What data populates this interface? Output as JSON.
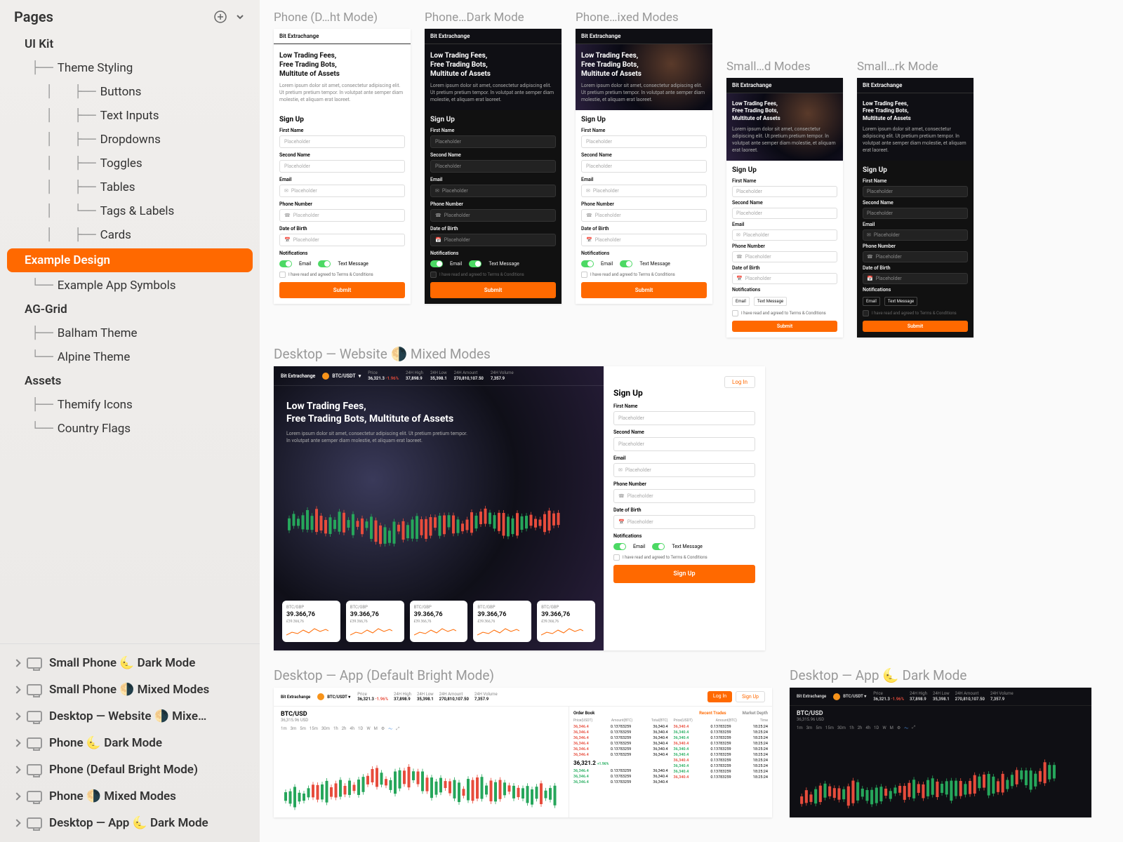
{
  "sidebar": {
    "title": "Pages",
    "sections": [
      {
        "label": "UI Kit",
        "type": "section"
      },
      {
        "label": "Theme Styling",
        "type": "child",
        "prefix": "├──"
      },
      {
        "label": "Buttons",
        "type": "gchild",
        "prefix": "├──"
      },
      {
        "label": "Text Inputs",
        "type": "gchild",
        "prefix": "├──"
      },
      {
        "label": "Dropdowns",
        "type": "gchild",
        "prefix": "├──"
      },
      {
        "label": "Toggles",
        "type": "gchild",
        "prefix": "├──"
      },
      {
        "label": "Tables",
        "type": "gchild",
        "prefix": "├──"
      },
      {
        "label": "Tags & Labels",
        "type": "gchild",
        "prefix": "└──"
      },
      {
        "label": "Cards",
        "type": "gchild",
        "prefix": "├──"
      },
      {
        "label": "Example Design",
        "type": "selected"
      },
      {
        "label": "Example App Symbols",
        "type": "child",
        "prefix": "└──"
      },
      {
        "label": "AG-Grid",
        "type": "section"
      },
      {
        "label": "Balham Theme",
        "type": "child",
        "prefix": "├──"
      },
      {
        "label": "Alpine Theme",
        "type": "child",
        "prefix": "└──"
      },
      {
        "label": "Assets",
        "type": "section"
      },
      {
        "label": "Themify Icons",
        "type": "child",
        "prefix": "├──"
      },
      {
        "label": "Country Flags",
        "type": "child",
        "prefix": "└──"
      }
    ],
    "artboards": [
      "Small Phone 🌜 Dark Mode",
      "Small Phone 🌗 Mixed Modes",
      "Desktop — Website 🌗 Mixe…",
      "Phone 🌜 Dark Mode",
      "Phone (Defaul Bright Mode)",
      "Phone 🌗 Mixed Modes",
      "Desktop — App 🌜 Dark Mode"
    ]
  },
  "canvas": {
    "row1": [
      {
        "label": "Phone (D…ht Mode)",
        "variant": "light"
      },
      {
        "label": "Phone…Dark Mode",
        "variant": "dark"
      },
      {
        "label": "Phone…ixed Modes",
        "variant": "mixed"
      },
      {
        "label": "Small…d Modes",
        "variant": "mixed",
        "small": true
      },
      {
        "label": "Small…rk Mode",
        "variant": "dark",
        "small": true
      }
    ],
    "row2_label": "Desktop — Website 🌗 Mixed Modes",
    "row3": [
      {
        "label": "Desktop — App (Default Bright Mode)",
        "variant": "light"
      },
      {
        "label": "Desktop — App 🌜 Dark Mode",
        "variant": "dark"
      }
    ]
  },
  "mock": {
    "brand": "Bit Extrachange",
    "hero_title_l1": "Low Trading Fees,",
    "hero_title_l2": "Free Trading Bots,",
    "hero_title_l3": "Multitute of Assets",
    "hero_title_combined": "Free Trading Bots, Multitute of Assets",
    "hero_text": "Lorem ipsum dolor sit amet, consectetur adipiscing elit. Ut pretium pretium tempor. In volutpat ante semper diam molestie, et aliquam erat laoreet.",
    "signup": "Sign Up",
    "login": "Log In",
    "fields": {
      "first": "First Name",
      "second": "Second Name",
      "email": "Email",
      "phone": "Phone Number",
      "dob": "Date of Birth"
    },
    "placeholder": "Placeholder",
    "notif_label": "Notifications",
    "notif_email": "Email",
    "notif_text": "Text Message",
    "terms": "I have read and agreed to Terms & Conditions",
    "submit": "Submit",
    "signup_btn": "Sign Up"
  },
  "ticker": {
    "pair": "BTC/USDT",
    "stats": [
      {
        "l": "Price",
        "v": "36,321.3",
        "d": "-1.96%"
      },
      {
        "l": "24H High",
        "v": "37,898.9"
      },
      {
        "l": "24H Low",
        "v": "35,398.1"
      },
      {
        "l": "24H Amount",
        "v": "270,810,107.50"
      },
      {
        "l": "24H Volume",
        "v": "7,357.9"
      }
    ],
    "cards": [
      {
        "pair": "BTC/GBP",
        "price": "39.366,76",
        "sub": "£39.366,76"
      },
      {
        "pair": "BTC/GBP",
        "price": "39.366,76",
        "sub": "£39.366,76"
      },
      {
        "pair": "BTC/GBP",
        "price": "39.366,76",
        "sub": "£39.366,76"
      },
      {
        "pair": "BTC/GBP",
        "price": "39.366,76",
        "sub": "£39.366,76"
      },
      {
        "pair": "BTC/GBP",
        "price": "39.366,76",
        "sub": "£39.366,76"
      }
    ]
  },
  "app": {
    "sym": "BTC/USD",
    "sub": "36,315.96 USD",
    "intervals": [
      "1m",
      "3m",
      "5m",
      "15m",
      "30m",
      "1h",
      "2h",
      "4h",
      "1D",
      "W",
      "M"
    ],
    "orderbook_tab": "Order Book",
    "trades_tab": "Recent Trades",
    "depth_tab": "Market Depth",
    "ob_hdr": [
      "Price(USDT)",
      "Amount(BTC)",
      "Total(BTC)"
    ],
    "rt_hdr": [
      "Price(USDT)",
      "Amount(BTC)",
      "Time"
    ],
    "asks": [
      [
        "36,346.4",
        "0.13783259",
        "36,340.4"
      ],
      [
        "36,346.4",
        "0.13783259",
        "36,340.4"
      ],
      [
        "36,346.4",
        "0.13783259",
        "36,340.4"
      ],
      [
        "36,346.4",
        "0.13783259",
        "36,340.4"
      ],
      [
        "36,346.4",
        "0.13783259",
        "36,340.4"
      ],
      [
        "36,346.4",
        "0.13783259",
        "36,340.4"
      ]
    ],
    "mid": "36,321.2",
    "mid_d": "+1.96%",
    "bids": [
      [
        "36,346.4",
        "0.13783259",
        "36,340.4"
      ],
      [
        "36,346.4",
        "0.13783259",
        "36,340.4"
      ],
      [
        "36,346.4",
        "0.13783259",
        "36,340.4"
      ]
    ],
    "trades": [
      [
        "36,340.4",
        "0.13783259",
        "18:25:24"
      ],
      [
        "36,340.4",
        "0.13783259",
        "18:25:24"
      ],
      [
        "36,340.4",
        "0.13783259",
        "18:25:24"
      ],
      [
        "36,340.4",
        "0.13783259",
        "18:25:24"
      ],
      [
        "36,340.4",
        "0.13783259",
        "18:25:24"
      ],
      [
        "36,340.4",
        "0.13783259",
        "18:25:24"
      ],
      [
        "36,340.4",
        "0.13783259",
        "18:25:24"
      ],
      [
        "36,340.4",
        "0.13783259",
        "18:25:24"
      ],
      [
        "36,340.4",
        "0.13783259",
        "18:25:24"
      ],
      [
        "36,340.4",
        "0.13783259",
        "18:25:24"
      ]
    ]
  }
}
